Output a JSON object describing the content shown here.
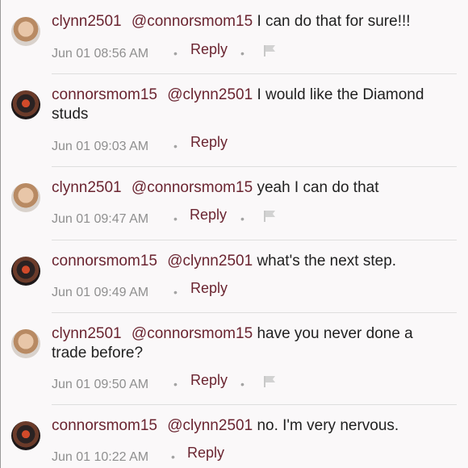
{
  "comments": [
    {
      "user": "clynn2501",
      "mention": "@connorsmom15",
      "text": "I can do that for sure!!!",
      "time": "Jun 01 08:56 AM",
      "reply": "Reply",
      "avatar": "avatar-clynn2501",
      "flag": true
    },
    {
      "user": "connorsmom15",
      "mention": "@clynn2501",
      "text": "I would like the Diamond studs",
      "time": "Jun 01 09:03 AM",
      "reply": "Reply",
      "avatar": "avatar-connorsmom15",
      "flag": false
    },
    {
      "user": "clynn2501",
      "mention": "@connorsmom15",
      "text": "yeah I can do that",
      "time": "Jun 01 09:47 AM",
      "reply": "Reply",
      "avatar": "avatar-clynn2501",
      "flag": true
    },
    {
      "user": "connorsmom15",
      "mention": "@clynn2501",
      "text": "what's the next step.",
      "time": "Jun 01 09:49 AM",
      "reply": "Reply",
      "avatar": "avatar-connorsmom15",
      "flag": false
    },
    {
      "user": "clynn2501",
      "mention": "@connorsmom15",
      "text": "have you never done a trade before?",
      "time": "Jun 01 09:50 AM",
      "reply": "Reply",
      "avatar": "avatar-clynn2501",
      "flag": true
    },
    {
      "user": "connorsmom15",
      "mention": "@clynn2501",
      "text": "no. I'm very nervous.",
      "time": "Jun 01 10:22 AM",
      "reply": "Reply",
      "avatar": "avatar-connorsmom15",
      "flag": false
    }
  ],
  "separator_glyph": "•",
  "colors": {
    "username": "#6a2430",
    "meta": "#8f8f8f",
    "text": "#1f1f1f",
    "background": "#faf8f9"
  }
}
